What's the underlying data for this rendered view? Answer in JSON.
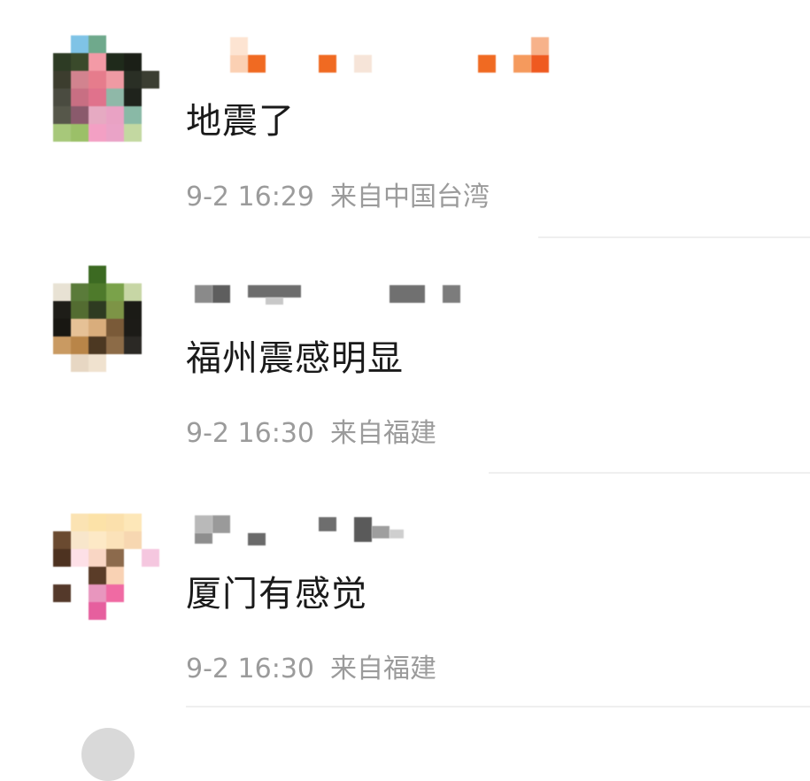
{
  "comments": [
    {
      "text": "地震了",
      "date": "9-2 16:29",
      "location": "来自中国台湾"
    },
    {
      "text": "福州震感明显",
      "date": "9-2 16:30",
      "location": "来自福建"
    },
    {
      "text": "厦门有感觉",
      "date": "9-2 16:30",
      "location": "来自福建"
    }
  ],
  "colors": {
    "comment_text": "#1a1a1a",
    "meta_text": "#9b9b9b",
    "divider": "#efefef",
    "name_mosaic_orange": "#f06a22",
    "name_mosaic_gray": "#7a7a7a"
  }
}
